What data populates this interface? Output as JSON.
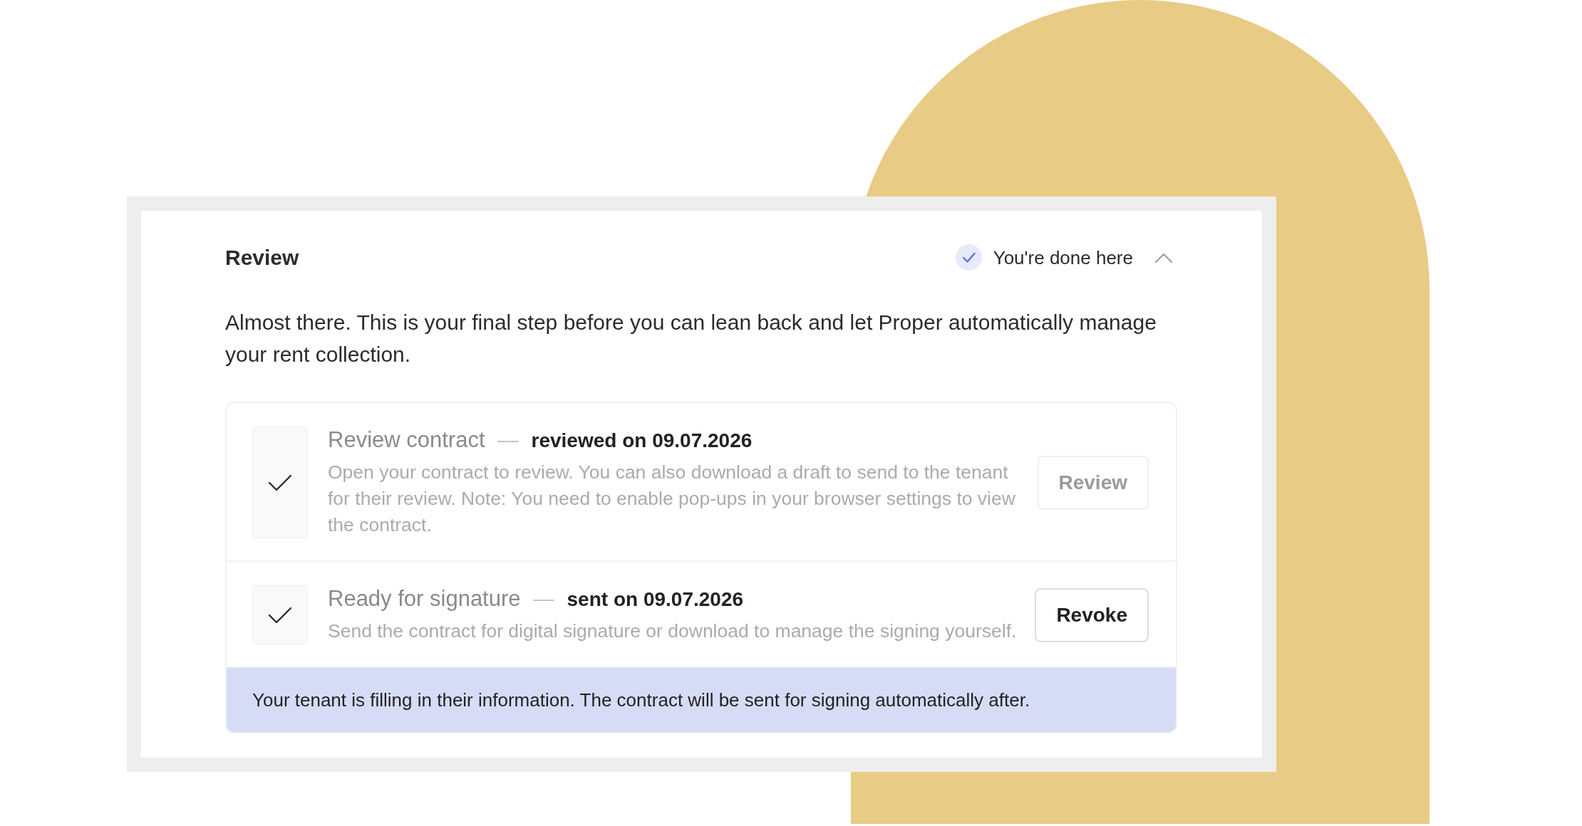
{
  "section": {
    "title": "Review",
    "status": {
      "label": "You're done here",
      "done": true
    },
    "expanded": true,
    "intro": "Almost there. This is your final step before you can lean back and let Proper automatically manage your rent collection.",
    "steps": [
      {
        "title": "Review contract",
        "separator": "—",
        "status": "reviewed on 09.07.2026",
        "description": "Open your contract to review. You can also download a draft to send to the tenant for their review. Note: You need to enable pop-ups in your browser settings to view the contract.",
        "checked": true,
        "action": {
          "label": "Review",
          "disabled": true
        }
      },
      {
        "title": "Ready for signature",
        "separator": "—",
        "status": "sent on 09.07.2026",
        "description": "Send the contract for digital signature or download to manage the signing yourself.",
        "checked": true,
        "action": {
          "label": "Revoke",
          "disabled": false
        }
      }
    ],
    "notice": "Your tenant is filling in their information. The contract will be sent for signing automatically after."
  }
}
